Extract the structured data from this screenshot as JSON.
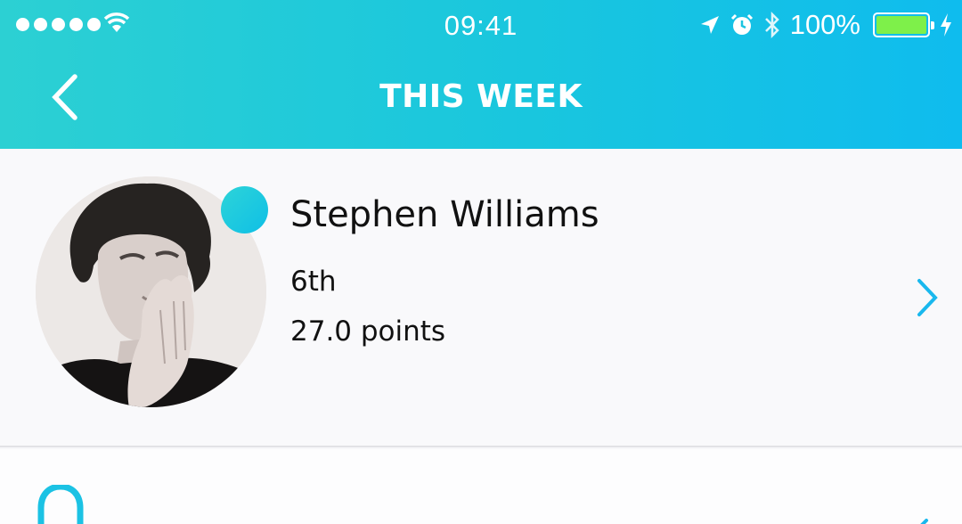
{
  "status_bar": {
    "time": "09:41",
    "battery_percent": "100%",
    "icons": [
      "signal-dots-icon",
      "wifi-icon",
      "location-arrow-icon",
      "alarm-icon",
      "bluetooth-icon",
      "battery-icon",
      "charging-bolt-icon"
    ]
  },
  "nav": {
    "title": "THIS WEEK",
    "back_icon": "chevron-left-icon"
  },
  "user_row": {
    "name": "Stephen Williams",
    "rank": "6th",
    "points": "27.0 points",
    "status_dot_color": "#19c6de",
    "chevron_icon": "chevron-right-icon"
  },
  "colors": {
    "header_gradient_start": "#2cd0d3",
    "header_gradient_end": "#0fbcee",
    "accent": "#19b8ee",
    "battery_fill": "#7ef04a"
  }
}
